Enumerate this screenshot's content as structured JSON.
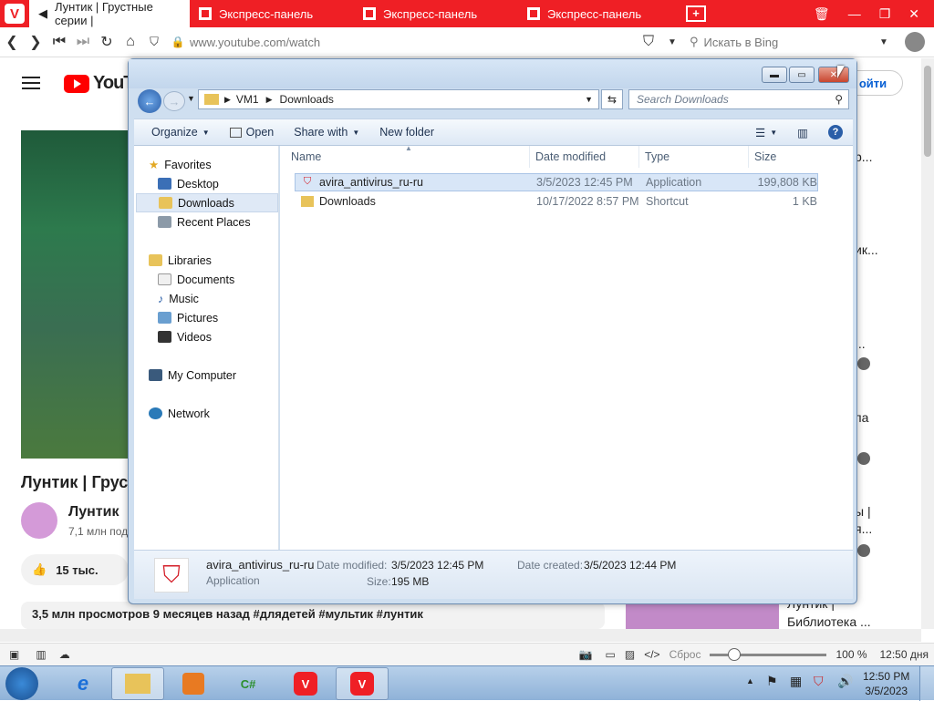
{
  "browser": {
    "tabs": [
      {
        "label": "Лунтик | Грустные серии |",
        "active": true
      },
      {
        "label": "Экспресс-панель"
      },
      {
        "label": "Экспресс-панель"
      },
      {
        "label": "Экспресс-панель"
      }
    ],
    "url_host": "www.youtube.com",
    "url_path": "/watch",
    "search_placeholder": "Искать в Bing"
  },
  "youtube": {
    "logo": "YouTu",
    "login_label": "ойти",
    "video_title": "Лунтик | Груст",
    "channel": "Лунтик",
    "subs": "7,1 млн под",
    "likes": "15 тыс.",
    "views_line": "3,5 млн просмотров  9 месяцев назад  #длядетей #мультик #лунтик",
    "side_snippets": [
      "р...",
      "ик...",
      "...",
      "па",
      "ы |",
      "я...",
      "Лунтик |",
      "Библиотека ..."
    ]
  },
  "explorer": {
    "breadcrumb": [
      "VM1",
      "Downloads"
    ],
    "search_placeholder": "Search Downloads",
    "toolbar": {
      "organize": "Organize",
      "open": "Open",
      "share": "Share with",
      "new_folder": "New folder"
    },
    "nav": {
      "favorites": "Favorites",
      "desktop": "Desktop",
      "downloads": "Downloads",
      "recent": "Recent Places",
      "libraries": "Libraries",
      "documents": "Documents",
      "music": "Music",
      "pictures": "Pictures",
      "videos": "Videos",
      "computer": "My Computer",
      "network": "Network"
    },
    "columns": {
      "name": "Name",
      "date": "Date modified",
      "type": "Type",
      "size": "Size"
    },
    "files": [
      {
        "name": "avira_antivirus_ru-ru",
        "date": "3/5/2023 12:45 PM",
        "type": "Application",
        "size": "199,808 KB"
      },
      {
        "name": "Downloads",
        "date": "10/17/2022 8:57 PM",
        "type": "Shortcut",
        "size": "1 KB"
      }
    ],
    "details": {
      "name": "avira_antivirus_ru-ru",
      "kind": "Application",
      "modified_label": "Date modified:",
      "modified_value": "3/5/2023 12:45 PM",
      "created_label": "Date created:",
      "created_value": "3/5/2023 12:44 PM",
      "size_label": "Size:",
      "size_value": "195 MB"
    }
  },
  "statusbar": {
    "reset": "Сброс",
    "zoom": "100 %",
    "clock": "12:50 дня"
  },
  "taskbar": {
    "time": "12:50 PM",
    "date": "3/5/2023"
  }
}
